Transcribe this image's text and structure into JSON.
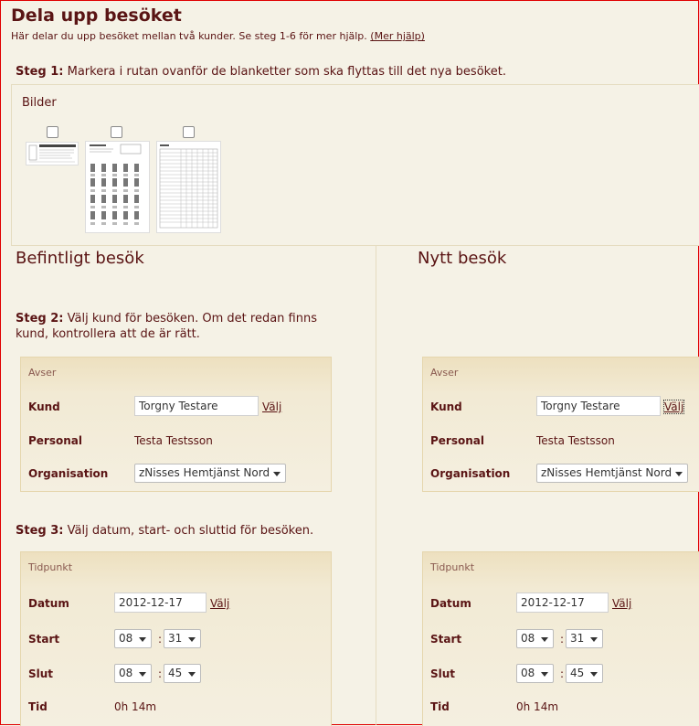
{
  "page": {
    "title": "Dela upp besöket",
    "subtitle": "Här delar du upp besöket mellan två kunder. Se steg 1-6 för mer hjälp.",
    "help_link": "(Mer hjälp)"
  },
  "step1": {
    "label": "Steg 1:",
    "text": "Markera i rutan ovanför de blanketter som ska flyttas till det nya besöket."
  },
  "images": {
    "label": "Bilder",
    "items": [
      {
        "checked": false
      },
      {
        "checked": false
      },
      {
        "checked": false
      }
    ]
  },
  "left": {
    "heading": "Befintligt besök",
    "step2_label": "Steg 2:",
    "step2_text": "Välj kund för besöken. Om det redan finns kund, kontrollera att de är rätt.",
    "avser": {
      "title": "Avser",
      "kund_label": "Kund",
      "kund_value": "Torgny Testare",
      "valj": "Välj",
      "personal_label": "Personal",
      "personal_value": "Testa Testsson",
      "org_label": "Organisation",
      "org_value": "zNisses Hemtjänst Nord"
    },
    "step3_label": "Steg 3:",
    "step3_text": "Välj datum, start- och sluttid för besöken.",
    "tidpunkt": {
      "title": "Tidpunkt",
      "datum_label": "Datum",
      "datum_value": "2012-12-17",
      "valj": "Välj",
      "start_label": "Start",
      "start_h": "08",
      "start_m": "31",
      "slut_label": "Slut",
      "slut_h": "08",
      "slut_m": "45",
      "tid_label": "Tid",
      "tid_value": "0h 14m",
      "colon": ":"
    }
  },
  "right": {
    "heading": "Nytt besök",
    "avser": {
      "title": "Avser",
      "kund_label": "Kund",
      "kund_value": "Torgny Testare",
      "valj": "Välj",
      "personal_label": "Personal",
      "personal_value": "Testa Testsson",
      "org_label": "Organisation",
      "org_value": "zNisses Hemtjänst Nord"
    },
    "tidpunkt": {
      "title": "Tidpunkt",
      "datum_label": "Datum",
      "datum_value": "2012-12-17",
      "valj": "Välj",
      "start_label": "Start",
      "start_h": "08",
      "start_m": "31",
      "slut_label": "Slut",
      "slut_h": "08",
      "slut_m": "45",
      "tid_label": "Tid",
      "tid_value": "0h 14m",
      "colon": ":"
    }
  }
}
